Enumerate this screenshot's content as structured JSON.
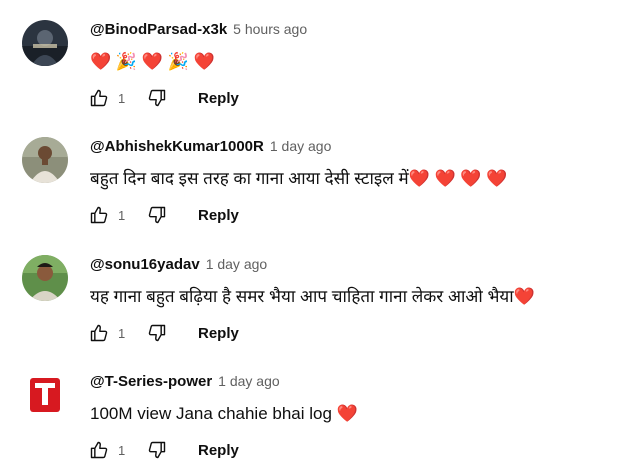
{
  "comments": [
    {
      "author": "@BinodParsad-x3k",
      "time": "5 hours ago",
      "text": "❤️ 🎉 ❤️ 🎉 ❤️",
      "likes": "1",
      "reply_label": "Reply",
      "avatar_icon": "dark-portrait-avatar"
    },
    {
      "author": "@AbhishekKumar1000R",
      "time": "1 day ago",
      "text": "बहुत दिन बाद इस तरह का गाना आया देसी स्टाइल में❤️ ❤️ ❤️ ❤️",
      "likes": "1",
      "reply_label": "Reply",
      "avatar_icon": "man-photo-avatar"
    },
    {
      "author": "@sonu16yadav",
      "time": "1 day ago",
      "text": "यह गाना बहुत बढ़िया है समर भैया आप चाहिता गाना लेकर आओ भैया❤️",
      "likes": "1",
      "reply_label": "Reply",
      "avatar_icon": "man-green-photo-avatar"
    },
    {
      "author": "@T-Series-power",
      "time": "1 day ago",
      "text": "100M view Jana chahie bhai log ❤️",
      "likes": "1",
      "reply_label": "Reply",
      "avatar_icon": "t-series-logo-avatar"
    }
  ],
  "colors": {
    "text": "#0f0f0f",
    "secondary": "#606060",
    "heart": "#e0245e",
    "tseries_red": "#d71920"
  }
}
